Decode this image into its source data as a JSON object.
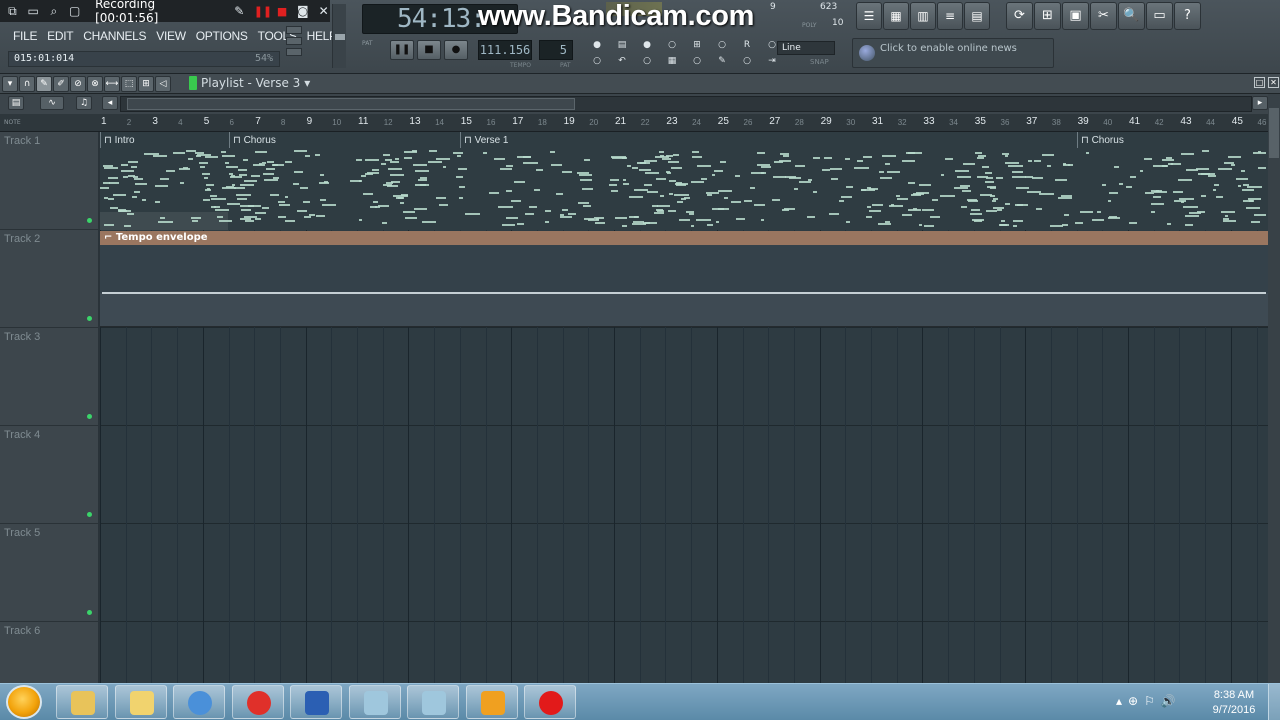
{
  "recorder": {
    "title": "Recording [00:01:56]",
    "icons": [
      "restore-icon",
      "window-icon",
      "search-icon",
      "screen-icon",
      "pencil-icon",
      "pause-icon",
      "record-icon",
      "camera-icon",
      "close-icon"
    ]
  },
  "watermark": "www.Bandicam.com",
  "menu": [
    "FILE",
    "EDIT",
    "CHANNELS",
    "VIEW",
    "OPTIONS",
    "TOOLS",
    "HELP"
  ],
  "position": {
    "time": "015:01:014",
    "percent": "54%"
  },
  "lcd": {
    "time": "54:13:"
  },
  "transport": {
    "pause": "❚❚",
    "stop": "■",
    "record": "●",
    "pat_label": "PAT",
    "song_label": "SONG"
  },
  "tempo": {
    "value": "111.156",
    "label": "TEMPO"
  },
  "pattern": {
    "value": "5",
    "label": "PAT"
  },
  "snap": {
    "value": "Line",
    "label": "SNAP"
  },
  "cpu": {
    "mem_top": "623",
    "mem_bottom": "10",
    "nine": "9",
    "poly": "POLY"
  },
  "news": {
    "text": "Click to enable online news"
  },
  "window_buttons": [
    "☰",
    "▦",
    "▥",
    "≡",
    "▤"
  ],
  "tool_buttons": [
    "⟳",
    "⊞",
    "▣",
    "✂",
    "🔍",
    "▭",
    "?"
  ],
  "playlist": {
    "title": "Playlist - Verse 3",
    "ruler_label": "NOTE",
    "markers": [
      {
        "label": "Intro",
        "bar": 1
      },
      {
        "label": "Chorus",
        "bar": 6
      },
      {
        "label": "Verse 1",
        "bar": 15
      },
      {
        "label": "Chorus",
        "bar": 39
      }
    ],
    "bar_numbers": [
      "1",
      "3",
      "5",
      "7",
      "9",
      "11",
      "13",
      "15",
      "17",
      "19",
      "21",
      "23",
      "25",
      "27",
      "29",
      "31",
      "33",
      "35",
      "37",
      "39",
      "41",
      "43",
      "45"
    ],
    "tracks": [
      "Track 1",
      "Track 2",
      "Track 3",
      "Track 4",
      "Track 5",
      "Track 6"
    ],
    "envelope_label": "Tempo envelope"
  },
  "taskbar": {
    "apps": [
      {
        "name": "explorer-app",
        "color": "#e8c35a"
      },
      {
        "name": "folder-app",
        "color": "#f1d36e"
      },
      {
        "name": "chrome-app",
        "color": "#4a90d9"
      },
      {
        "name": "opera-app",
        "color": "#e0302a"
      },
      {
        "name": "word-app",
        "color": "#2b5fb3"
      },
      {
        "name": "app-6",
        "color": "#9fc7dd"
      },
      {
        "name": "app-7",
        "color": "#9fc7dd"
      },
      {
        "name": "flstudio-app",
        "color": "#f0a020"
      },
      {
        "name": "bandicam-app",
        "color": "#e21a1a"
      }
    ],
    "time": "8:38 AM",
    "date": "9/7/2016"
  }
}
